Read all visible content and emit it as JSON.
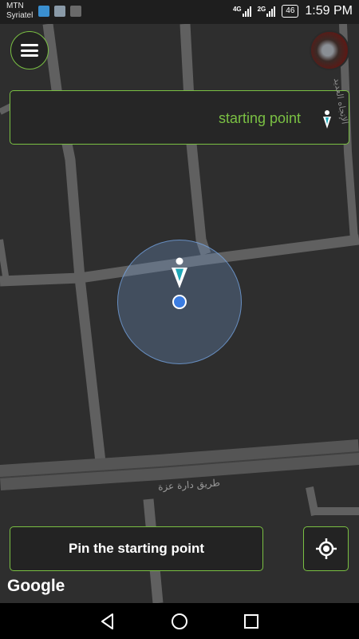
{
  "status_bar": {
    "carrier_line1": "MTN",
    "carrier_line2": "Syriatel",
    "network1": "4G",
    "network2": "2G",
    "battery": "46",
    "time": "1:59 PM"
  },
  "search": {
    "starting_point_label": "starting point"
  },
  "map": {
    "street_name": "طريق دارة عزة",
    "street_name_2": "الإتجاه العديد",
    "attribution": "Google"
  },
  "actions": {
    "pin_button_label": "Pin the starting point"
  },
  "icons": {
    "menu": "hamburger-menu-icon",
    "avatar": "user-avatar",
    "pin": "map-pin-icon",
    "locate": "my-location-icon",
    "back": "back-triangle-icon",
    "home": "home-circle-icon",
    "recents": "recents-square-icon"
  },
  "colors": {
    "accent": "#7ac043",
    "map_background": "#2e2e2e",
    "road": "#5d5d5d",
    "location_dot": "#3b7ce0",
    "pin_teal": "#1fa8b8"
  }
}
